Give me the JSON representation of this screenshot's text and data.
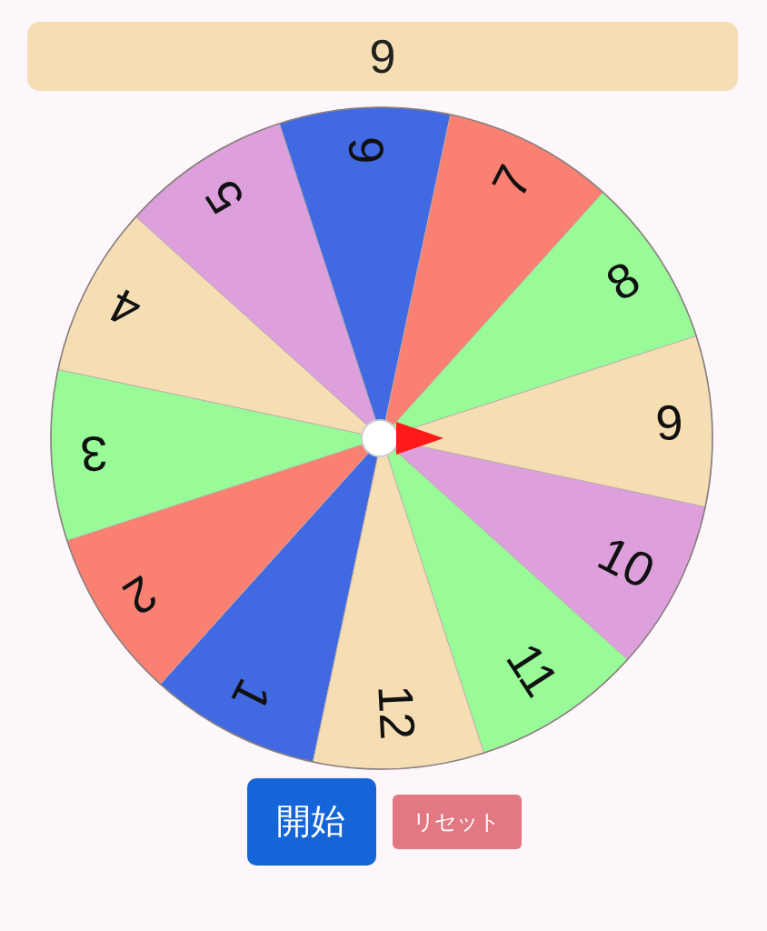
{
  "result": "9",
  "segments": [
    {
      "label": "1",
      "color": "#4169e1"
    },
    {
      "label": "2",
      "color": "#fa8072"
    },
    {
      "label": "3",
      "color": "#98fb98"
    },
    {
      "label": "4",
      "color": "#f5deb3"
    },
    {
      "label": "5",
      "color": "#dda0dd"
    },
    {
      "label": "6",
      "color": "#4169e1"
    },
    {
      "label": "7",
      "color": "#fa8072"
    },
    {
      "label": "8",
      "color": "#98fb98"
    },
    {
      "label": "9",
      "color": "#f5deb3"
    },
    {
      "label": "10",
      "color": "#dda0dd"
    },
    {
      "label": "11",
      "color": "#98fb98"
    },
    {
      "label": "12",
      "color": "#f5deb3"
    }
  ],
  "buttons": {
    "start": "開始",
    "reset": "リセット"
  }
}
